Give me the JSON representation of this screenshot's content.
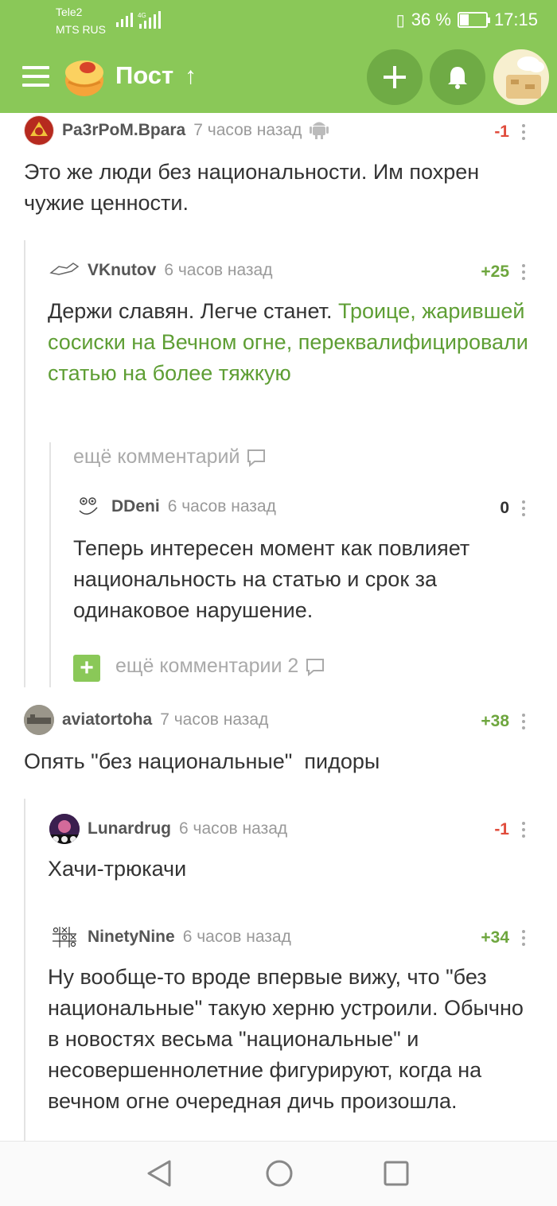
{
  "status_bar": {
    "carrier1": "Tele2",
    "carrier2": "MTS RUS",
    "battery": "36 %",
    "battery_level": 0.36,
    "time": "17:15"
  },
  "app_bar": {
    "title": "Пост",
    "up_arrow": "↑",
    "menu_icon": "hamburger-icon",
    "add_icon": "plus-icon",
    "bell_icon": "bell-icon"
  },
  "colors": {
    "accent": "#8ac858",
    "accent_dark": "#6fab45",
    "link": "#5e9e34",
    "negative": "#e04c3c",
    "positive": "#6ea63e"
  },
  "comments": [
    {
      "user": "Pa3rPoM.Bpara",
      "time": "7 часов назад",
      "rating": "-1",
      "text": "Это же люди без национальности. Им похрен чужие ценности.",
      "device_icon": "android-icon"
    },
    {
      "user": "VKnutov",
      "time": "6 часов назад",
      "rating": "+25",
      "text": "Держи славян. Легче станет. ",
      "link": "Троице, жарившей сосиски на Вечном огне, переквалифицировали статью на более тяжкую"
    },
    {
      "more": "ещё комментарий"
    },
    {
      "user": "DDeni",
      "time": "6 часов назад",
      "rating": "0",
      "text": "Теперь интересен момент как повлияет национальность на статью и срок за одинаковое нарушение."
    },
    {
      "more": "ещё комментарии 2",
      "plus": "+"
    },
    {
      "user": "aviatortoha",
      "time": "7 часов назад",
      "rating": "+38",
      "text": "Опять \"без национальные\"  пидоры"
    },
    {
      "user": "Lunardrug",
      "time": "6 часов назад",
      "rating": "-1",
      "text": "Хачи-трюкачи"
    },
    {
      "user": "NinetyNine",
      "time": "6 часов назад",
      "rating": "+34",
      "text": "Ну вообще-то вроде впервые вижу, что \"без национальные\" такую херню устроили. Обычно в новостях весьма \"национальные\" и несовершеннолетние фигурируют, когда на вечном огне очередная дичь произошла."
    }
  ],
  "nav_bar": {
    "back_icon": "back-triangle-icon",
    "home_icon": "home-circle-icon",
    "recents_icon": "recents-square-icon"
  }
}
